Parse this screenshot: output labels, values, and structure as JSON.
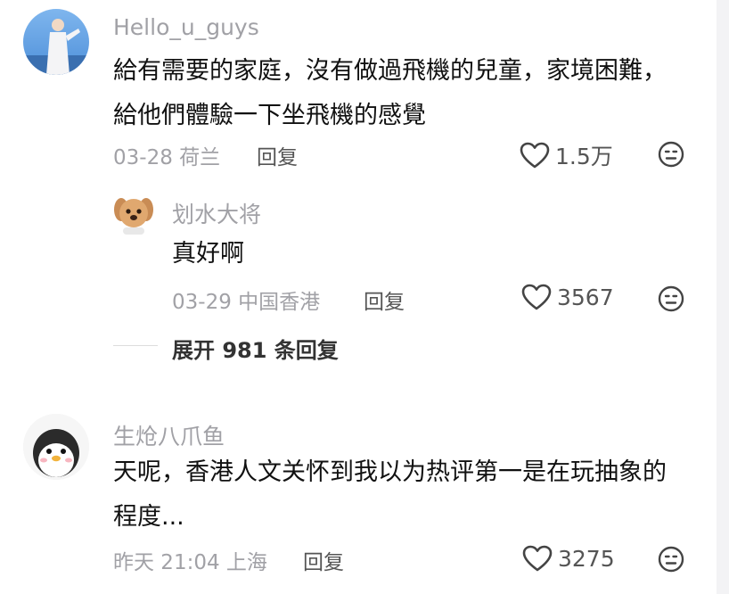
{
  "comments": [
    {
      "username": "Hello_u_guys",
      "text": "給有需要的家庭，沒有做過飛機的兒童，家境困難，給他們體驗一下坐飛機的感覺",
      "date_location": "03-28 荷兰",
      "reply_label": "回复",
      "likes": "1.5万",
      "reply": {
        "username": "划水大将",
        "text": "真好啊",
        "date_location": "03-29 中国香港",
        "reply_label": "回复",
        "likes": "3567"
      },
      "expand_label": "展开 981 条回复"
    },
    {
      "username": "生炝八爪鱼",
      "text": "天呢，香港人文关怀到我以为热评第一是在玩抽象的程度...",
      "date_location": "昨天 21:04 上海",
      "reply_label": "回复",
      "likes": "3275"
    }
  ],
  "colors": {
    "username": "#a1a1a6",
    "body_text": "#111111",
    "secondary": "#555555"
  }
}
